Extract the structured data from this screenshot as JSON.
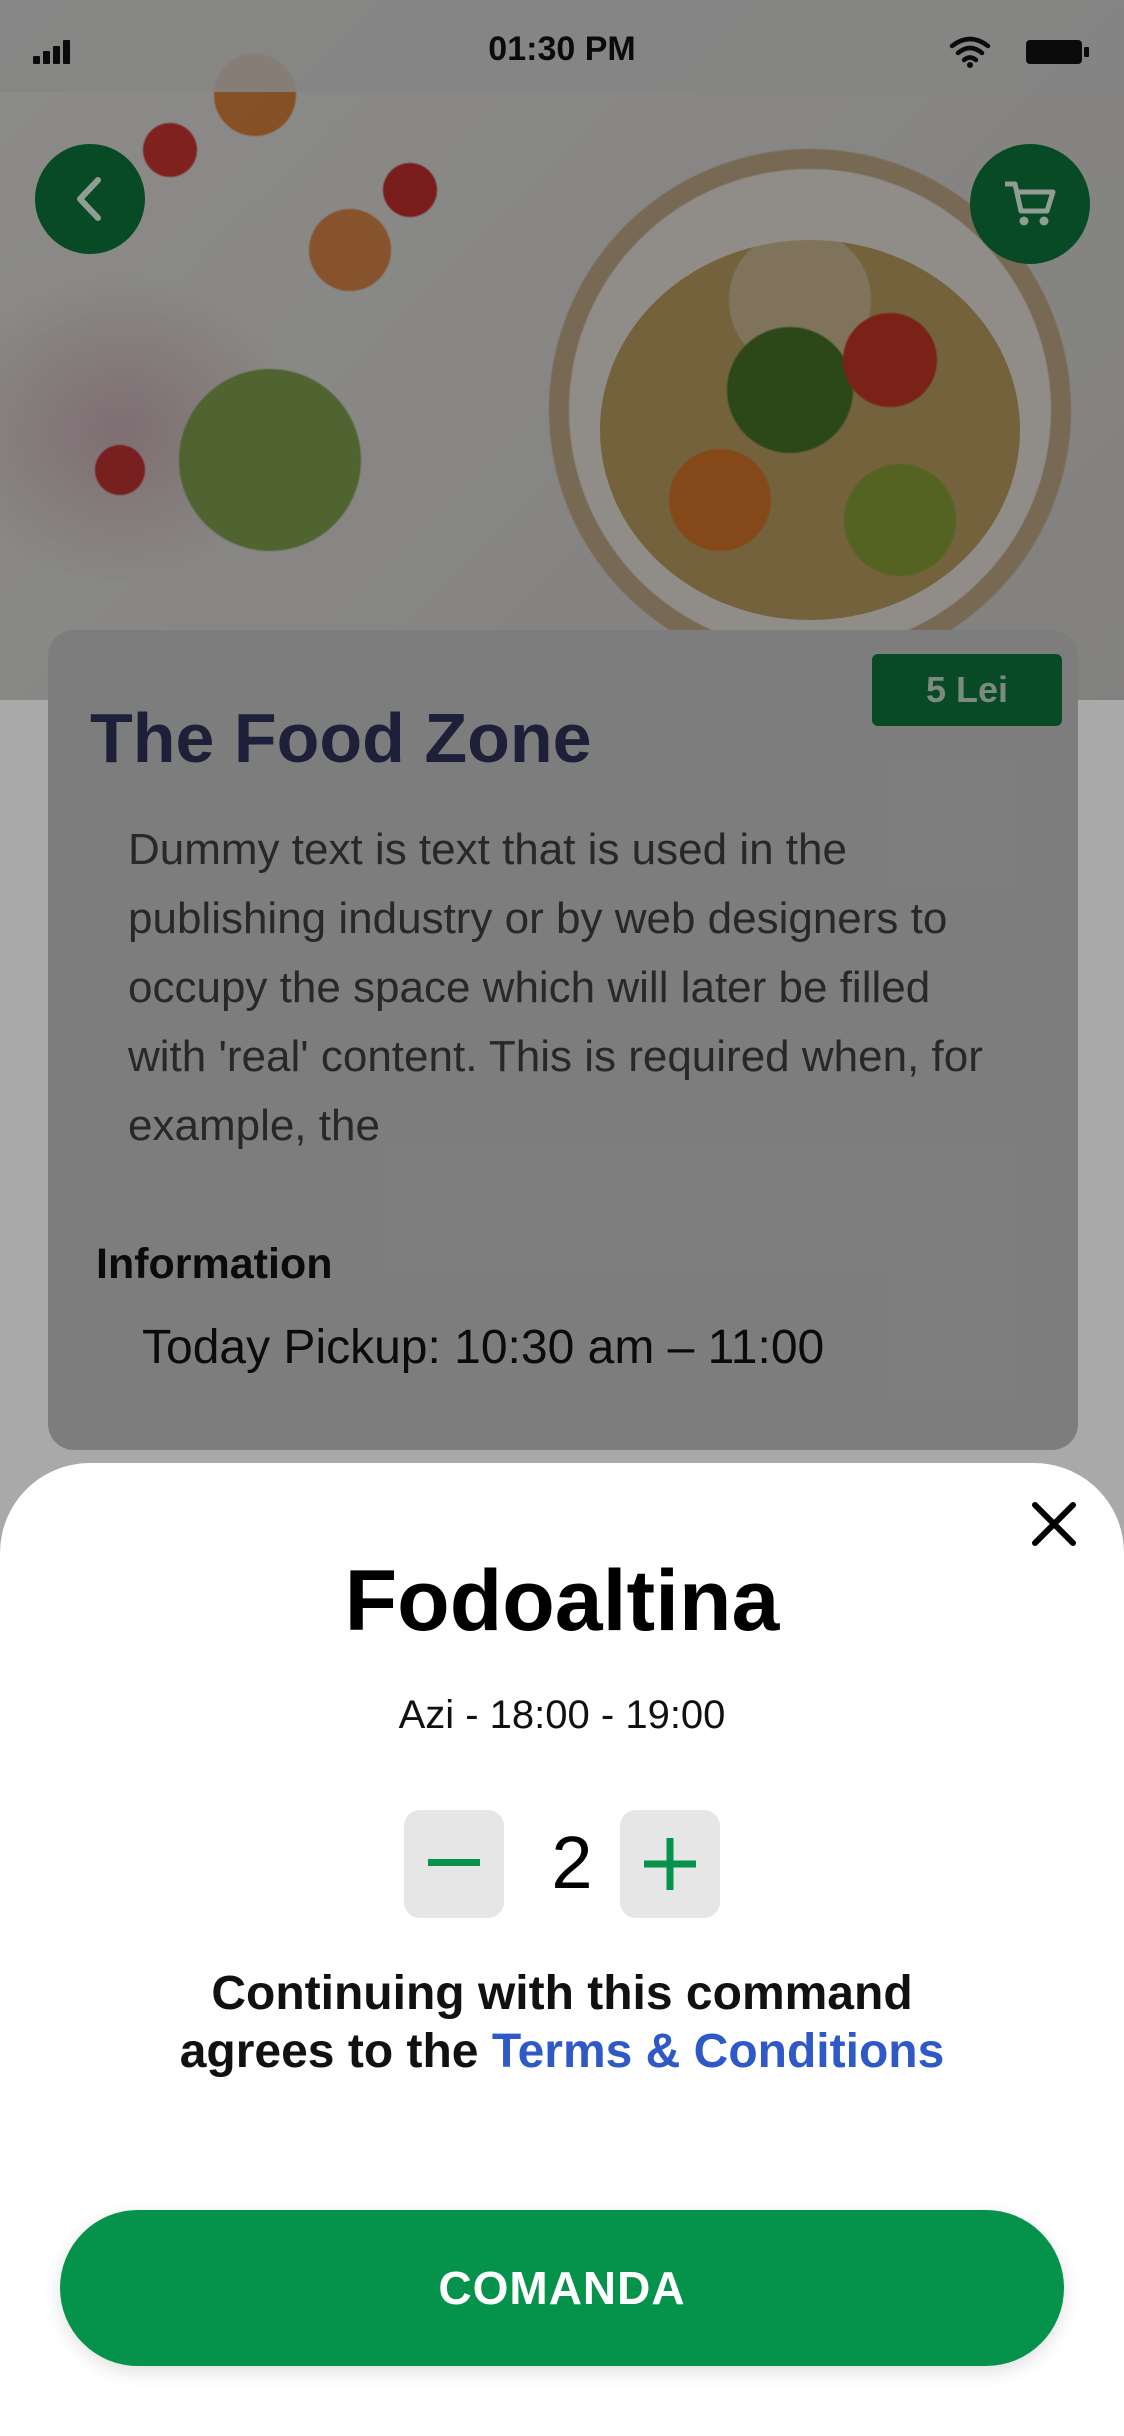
{
  "status_bar": {
    "time": "01:30 PM"
  },
  "header": {
    "back_icon": "chevron-left-icon",
    "cart_icon": "shopping-cart-icon"
  },
  "restaurant": {
    "price_badge": "5 Lei",
    "name": "The Food Zone",
    "description": "Dummy text is text that is used in the publishing industry or by web designers to occupy the space which will later be filled with 'real' content. This is required when, for example, the",
    "info_heading": "Information",
    "pickup": "Today Pickup: 10:30 am – 11:00"
  },
  "sheet": {
    "product": "Fodoaltina",
    "slot": "Azi - 18:00 - 19:00",
    "quantity": "2",
    "terms_text": "Continuing with this command agrees to the ",
    "terms_link": "Terms & Conditions",
    "cta_label": "COMANDA"
  },
  "colors": {
    "brand_green": "#05924a",
    "dark_green": "#0b6a35",
    "link_blue": "#2f59c6",
    "title_navy": "#2b2f52"
  }
}
